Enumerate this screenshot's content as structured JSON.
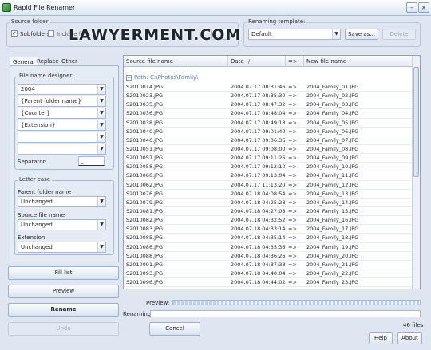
{
  "window": {
    "title": "Rapid File Renamer"
  },
  "source": {
    "group_label": "Source folder",
    "subfolders_label": "Subfolders",
    "option2_label": "Include files",
    "browse_label": "..."
  },
  "template": {
    "group_label": "Renaming template:",
    "value": "Default",
    "save_label": "Save as...",
    "delete_label": "Delete"
  },
  "watermark": "LAWYERMENT.COM",
  "tabs": [
    "General",
    "Replace",
    "Other"
  ],
  "designer": {
    "group_label": "File name designer",
    "fields": [
      "2004",
      "{Parent folder name}",
      "{Counter}",
      "{Extension}",
      "",
      ""
    ],
    "separator_label": "Separator:",
    "separator_value": "_"
  },
  "letter_case": {
    "group_label": "Letter case",
    "parent_label": "Parent folder name",
    "parent_value": "Unchanged",
    "source_label": "Source file name",
    "source_value": "Unchanged",
    "ext_label": "Extension",
    "ext_value": "Unchanged"
  },
  "buttons": {
    "fill": "Fill list",
    "preview": "Preview",
    "rename": "Rename",
    "undo": "Undo",
    "cancel": "Cancel",
    "help": "Help",
    "about": "About"
  },
  "grid": {
    "columns": [
      "Source file name",
      "Date",
      "=>",
      "New file name"
    ],
    "sort_indicator": "/",
    "path": "Path: C:\\Photos\\Family\\",
    "rows": [
      {
        "src": "S2010014.JPG",
        "date": "2004.07.17 08:31:46",
        "arrow": "=>",
        "dst": "2004_Family_01.JPG"
      },
      {
        "src": "S2010023.JPG",
        "date": "2004.07.17 08:35:30",
        "arrow": "=>",
        "dst": "2004_Family_02.JPG"
      },
      {
        "src": "S2010035.JPG",
        "date": "2004.07.17 08:47:32",
        "arrow": "=>",
        "dst": "2004_Family_03.JPG"
      },
      {
        "src": "S2010036.JPG",
        "date": "2004.07.17 08:48:04",
        "arrow": "=>",
        "dst": "2004_Family_04.JPG"
      },
      {
        "src": "S2010038.JPG",
        "date": "2004.07.17 08:49:18",
        "arrow": "=>",
        "dst": "2004_Family_05.JPG"
      },
      {
        "src": "S2010040.JPG",
        "date": "2004.07.17 09:01:40",
        "arrow": "=>",
        "dst": "2004_Family_06.JPG"
      },
      {
        "src": "S2010046.JPG",
        "date": "2004.07.17 09:06:36",
        "arrow": "=>",
        "dst": "2004_Family_07.JPG"
      },
      {
        "src": "S2010051.JPG",
        "date": "2004.07.17 09:08:00",
        "arrow": "=>",
        "dst": "2004_Family_08.JPG"
      },
      {
        "src": "S2010057.JPG",
        "date": "2004.07.17 09:11:26",
        "arrow": "=>",
        "dst": "2004_Family_09.JPG"
      },
      {
        "src": "S2010058.JPG",
        "date": "2004.07.17 09:12:10",
        "arrow": "=>",
        "dst": "2004_Family_10.JPG"
      },
      {
        "src": "S2010060.JPG",
        "date": "2004.07.17 09:13:04",
        "arrow": "=>",
        "dst": "2004_Family_11.JPG"
      },
      {
        "src": "S2010062.JPG",
        "date": "2004.07.17 11:13:20",
        "arrow": "=>",
        "dst": "2004_Family_12.JPG"
      },
      {
        "src": "S2010076.JPG",
        "date": "2004.07.18 04:08:54",
        "arrow": "=>",
        "dst": "2004_Family_13.JPG"
      },
      {
        "src": "S2010079.JPG",
        "date": "2004.07.18 04:25:28",
        "arrow": "=>",
        "dst": "2004_Family_14.JPG"
      },
      {
        "src": "S2010081.JPG",
        "date": "2004.07.18 04:27:08",
        "arrow": "=>",
        "dst": "2004_Family_15.JPG"
      },
      {
        "src": "S2010082.JPG",
        "date": "2004.07.18 04:32:52",
        "arrow": "=>",
        "dst": "2004_Family_16.JPG"
      },
      {
        "src": "S2010083.JPG",
        "date": "2004.07.18 04:33:14",
        "arrow": "=>",
        "dst": "2004_Family_17.JPG"
      },
      {
        "src": "S2010085.JPG",
        "date": "2004.07.18 04:35:14",
        "arrow": "=>",
        "dst": "2004_Family_18.JPG"
      },
      {
        "src": "S2010086.JPG",
        "date": "2004.07.18 04:35:36",
        "arrow": "=>",
        "dst": "2004_Family_19.JPG"
      },
      {
        "src": "S2010088.JPG",
        "date": "2004.07.18 04:36:26",
        "arrow": "=>",
        "dst": "2004_Family_20.JPG"
      },
      {
        "src": "S2010091.JPG",
        "date": "2004.07.18 04:37:38",
        "arrow": "=>",
        "dst": "2004_Family_21.JPG"
      },
      {
        "src": "S2010093.JPG",
        "date": "2004.07.18 04:40:04",
        "arrow": "=>",
        "dst": "2004_Family_22.JPG"
      },
      {
        "src": "S2010096.JPG",
        "date": "2004.07.18 04:44:02",
        "arrow": "=>",
        "dst": "2004_Family_23.JPG"
      }
    ]
  },
  "status": {
    "preview_label": "Preview:",
    "renaming_label": "Renaming:",
    "file_count": "46 files"
  },
  "icons": {
    "minimize": "window-minimize-icon",
    "close": "window-close-icon",
    "combo_arrow": "chevron-down-icon",
    "check": "check-icon"
  }
}
